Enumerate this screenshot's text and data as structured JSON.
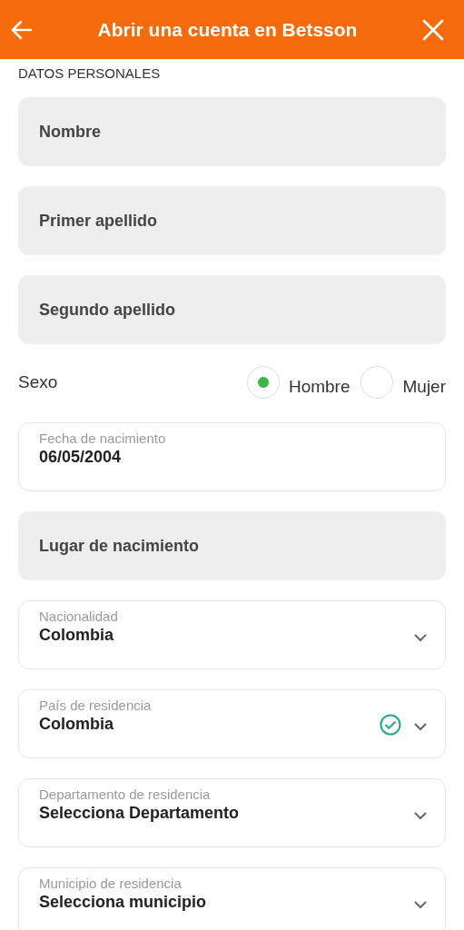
{
  "header": {
    "title": "Abrir una cuenta en Betsson"
  },
  "section_title": "DATOS PERSONALES",
  "fields": [
    {
      "kind": "input",
      "placeholder": "Nombre"
    },
    {
      "kind": "input",
      "placeholder": "Primer apellido"
    },
    {
      "kind": "input",
      "placeholder": "Segundo apellido"
    },
    {
      "kind": "radio",
      "label": "Sexo",
      "options": [
        {
          "label": "Hombre",
          "selected": true
        },
        {
          "label": "Mujer",
          "selected": false
        }
      ]
    },
    {
      "kind": "date",
      "label": "Fecha de nacimiento",
      "value": "06/05/2004"
    },
    {
      "kind": "input",
      "placeholder": "Lugar de nacimiento"
    },
    {
      "kind": "select",
      "label": "Nacionalidad",
      "value": "Colombia",
      "valid": false
    },
    {
      "kind": "select",
      "label": "País de residencia",
      "value": "Colombia",
      "valid": true
    },
    {
      "kind": "select",
      "label": "Departamento de residencia",
      "value": "Selecciona Departamento",
      "valid": false
    },
    {
      "kind": "select",
      "label": "Municipio de residencia",
      "value": "Selecciona municipio",
      "valid": false
    }
  ]
}
